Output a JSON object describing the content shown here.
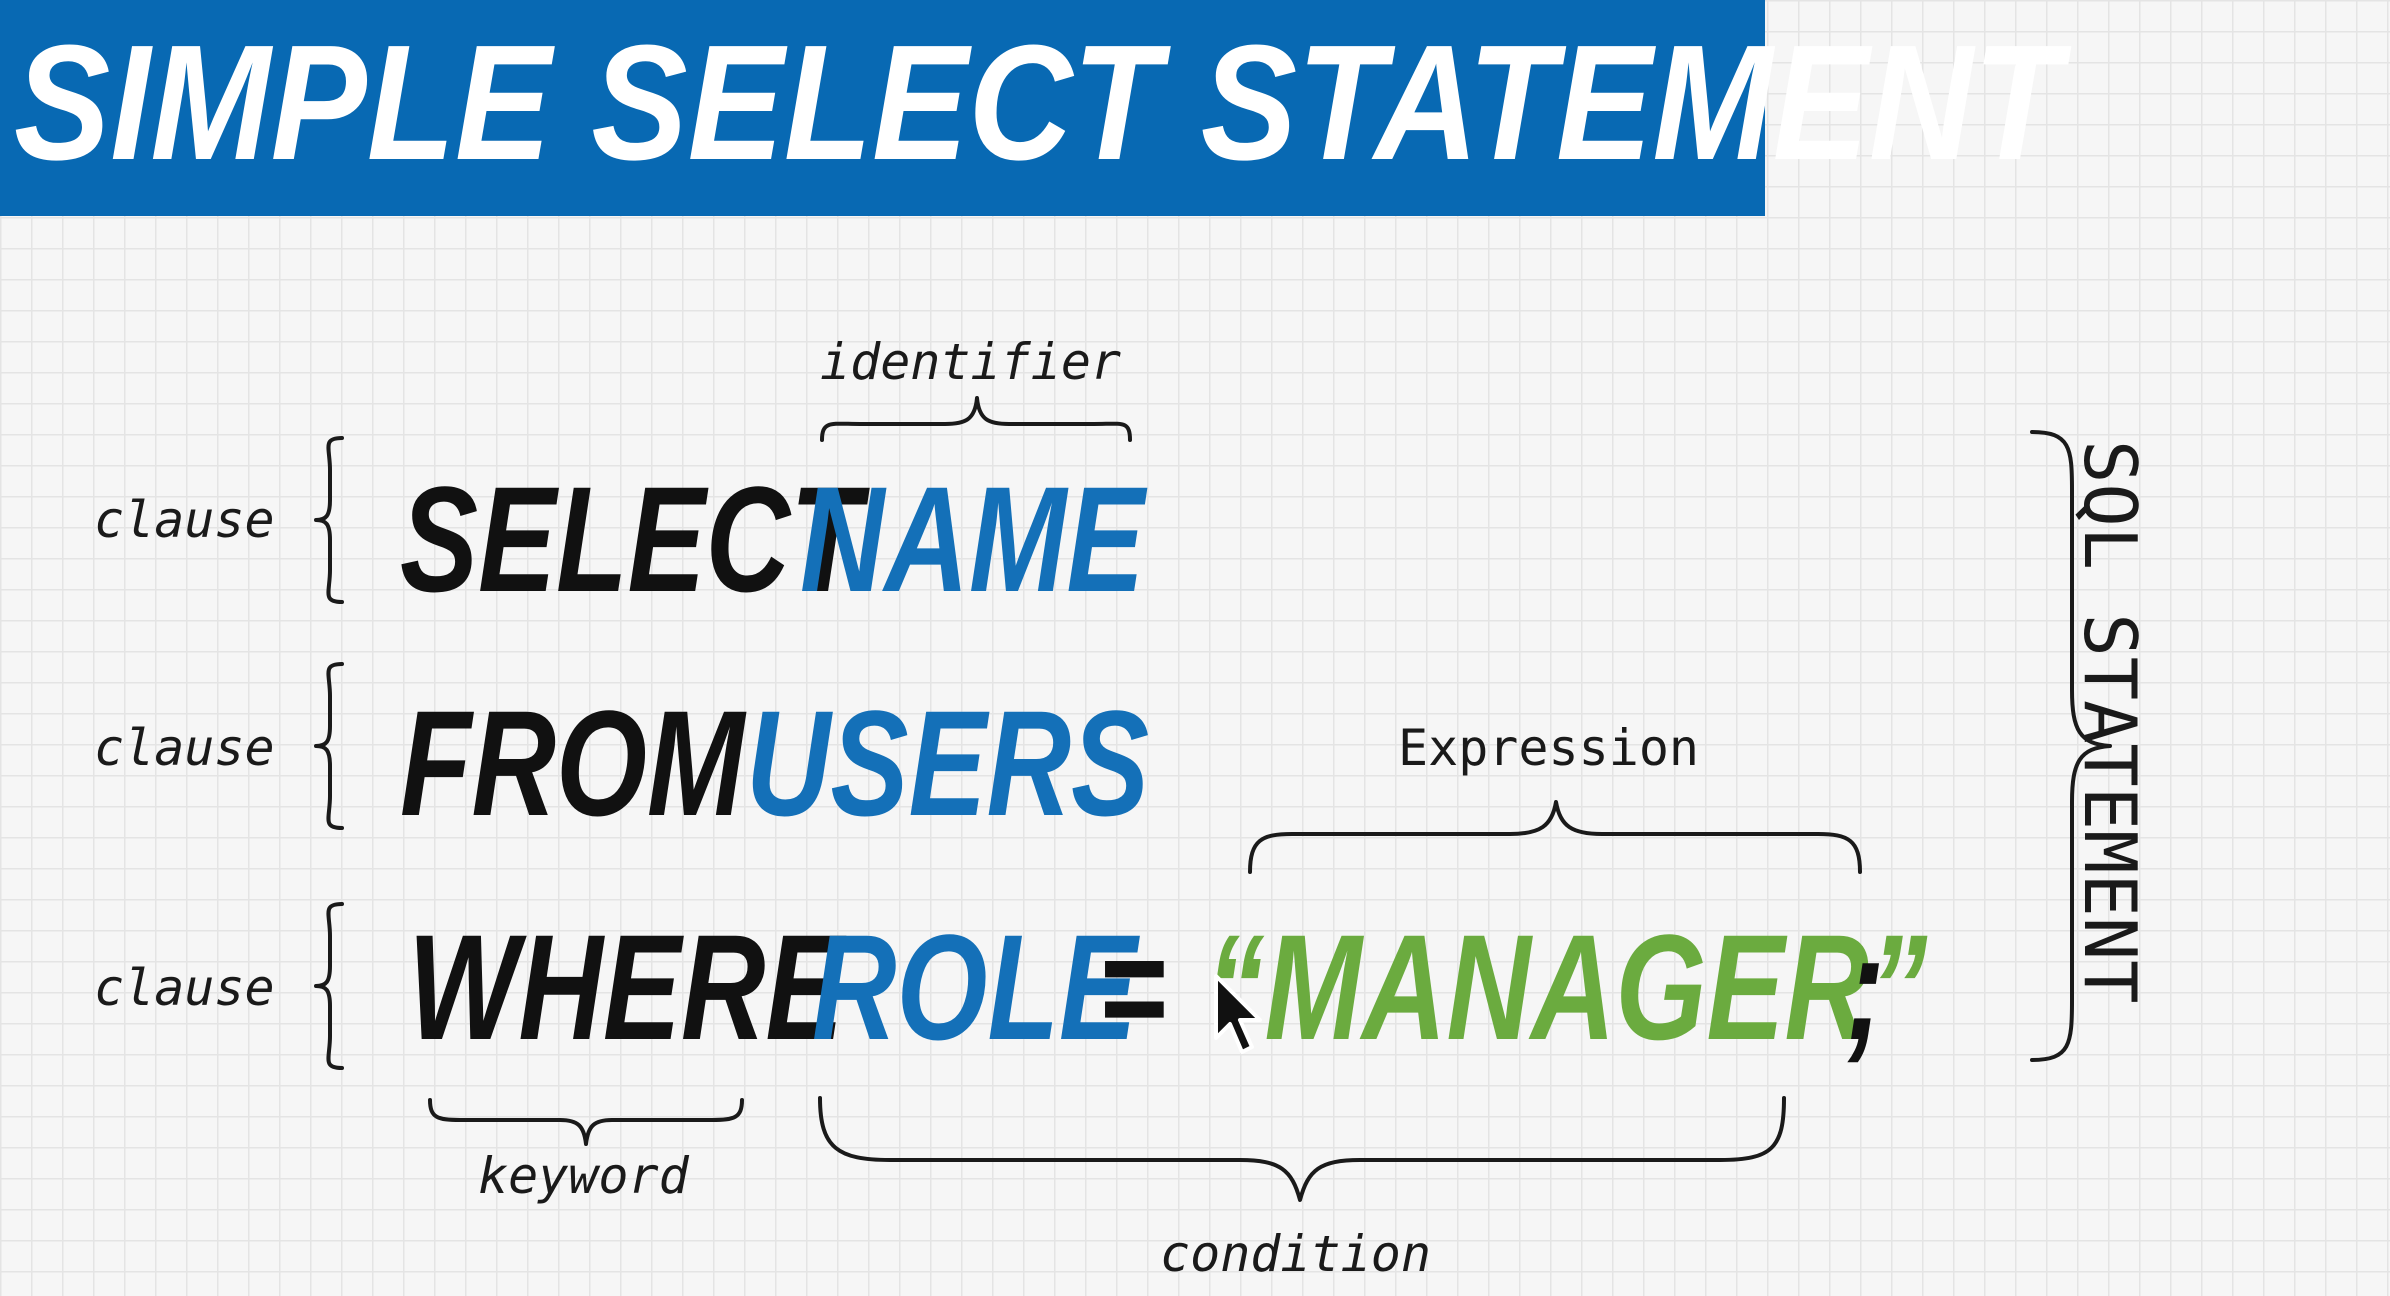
{
  "title": "SIMPLE SELECT STATEMENT",
  "lines": [
    {
      "keyword": "SELECT",
      "identifier": "NAME",
      "clause_label": "clause"
    },
    {
      "keyword": "FROM",
      "identifier": "USERS",
      "clause_label": "clause"
    },
    {
      "keyword": "WHERE",
      "identifier": "ROLE",
      "operator": "=",
      "value": "“MANAGER”",
      "terminator": ";",
      "clause_label": "clause"
    }
  ],
  "annotations": {
    "identifier": "identifier",
    "expression": "Expression",
    "keyword": "keyword",
    "condition": "condition",
    "statement": "SQL STATEMENT"
  },
  "colors": {
    "banner": "#0869b3",
    "keyword": "#111111",
    "identifier": "#1470b8",
    "string": "#6bab3f"
  },
  "icons": [
    "cursor-pointer-icon"
  ]
}
